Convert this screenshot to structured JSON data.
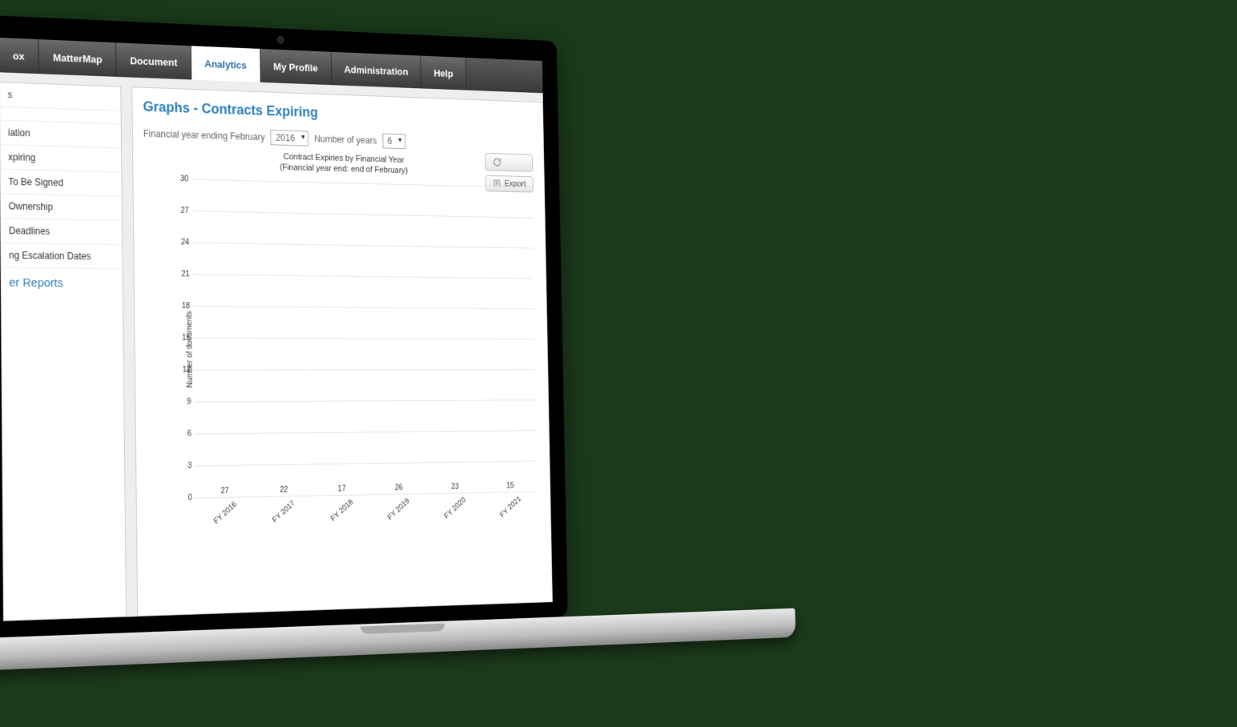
{
  "nav": {
    "tabs": [
      {
        "label": "ox"
      },
      {
        "label": "MatterMap"
      },
      {
        "label": "Document"
      },
      {
        "label": "Analytics"
      },
      {
        "label": "My Profile"
      },
      {
        "label": "Administration"
      },
      {
        "label": "Help"
      }
    ],
    "active_index": 3
  },
  "sidebar": {
    "items": [
      {
        "label": "s"
      },
      {
        "label": ""
      },
      {
        "label": "iation"
      },
      {
        "label": "xpiring"
      },
      {
        "label": "To Be Signed"
      },
      {
        "label": "Ownership"
      },
      {
        "label": "Deadlines"
      },
      {
        "label": "ng Escalation Dates"
      }
    ],
    "footer_header": "er Reports"
  },
  "page": {
    "title": "Graphs - Contracts Expiring",
    "fy_label": "Financial year ending February",
    "fy_value": "2016",
    "years_label": "Number of years",
    "years_value": "6",
    "export_label": "Export"
  },
  "chart_data": {
    "type": "bar",
    "title": "Contract Expiries by Financial Year",
    "subtitle": "(Financial year end: end of February)",
    "ylabel": "Number of documents",
    "xlabel": "",
    "ylim": [
      0,
      30
    ],
    "ystep": 3,
    "categories": [
      "FY 2016",
      "FY 2017",
      "FY 2018",
      "FY 2019",
      "FY 2020",
      "FY 2021"
    ],
    "values": [
      27,
      22,
      17,
      26,
      23,
      15
    ]
  }
}
